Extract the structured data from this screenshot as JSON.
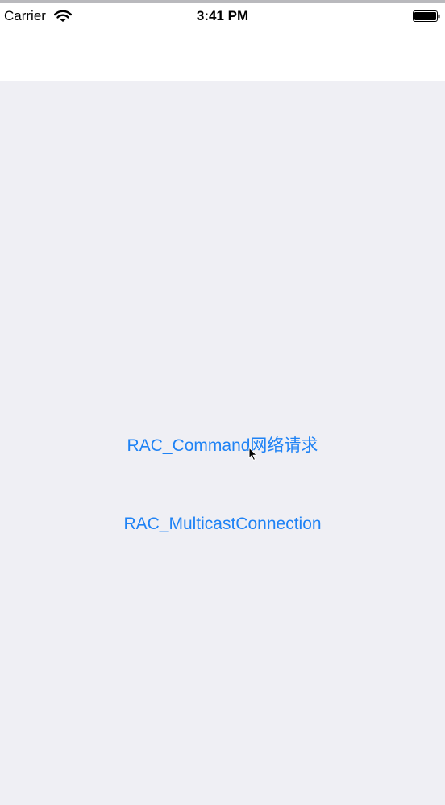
{
  "status_bar": {
    "carrier": "Carrier",
    "time": "3:41 PM",
    "wifi_icon": "wifi-icon",
    "battery_icon": "battery-icon"
  },
  "buttons": {
    "command_label": "RAC_Command网络请求",
    "multicast_label": "RAC_MulticastConnection"
  },
  "colors": {
    "background": "#efeff4",
    "nav_background": "#ffffff",
    "tint": "#1e82f5"
  },
  "cursor_icon": "mouse-pointer-icon"
}
